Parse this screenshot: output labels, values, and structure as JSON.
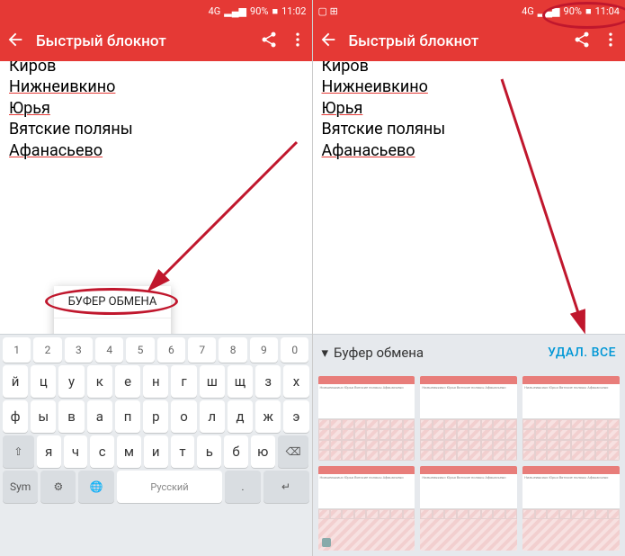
{
  "left": {
    "status": {
      "network": "4G",
      "signal": "▂▄▆",
      "battery_pct": "90%",
      "time": "11:02"
    },
    "appbar": {
      "title": "Быстрый блокнот"
    },
    "notes": [
      "Киров",
      "Нижнеивкино",
      "Юрья",
      "Вятские поляны",
      "Афанасьево"
    ],
    "underlined": [
      "Нижнеивкино",
      "Юрья",
      "Афанасьево"
    ],
    "popup": {
      "label": "БУФЕР ОБМЕНА",
      "back": "←"
    },
    "keyboard": {
      "nums": [
        "1",
        "2",
        "3",
        "4",
        "5",
        "6",
        "7",
        "8",
        "9",
        "0"
      ],
      "row1": [
        "й",
        "ц",
        "у",
        "к",
        "е",
        "н",
        "г",
        "ш",
        "щ",
        "з",
        "х"
      ],
      "row2": [
        "ф",
        "ы",
        "в",
        "а",
        "п",
        "р",
        "о",
        "л",
        "д",
        "ж",
        "э"
      ],
      "row3": [
        "я",
        "ч",
        "с",
        "м",
        "и",
        "т",
        "ь",
        "б",
        "ю"
      ],
      "shift": "⇧",
      "bksp": "⌫",
      "sym": "Sym",
      "gear": "⚙",
      "globe": "🌐",
      "lang": "Русский",
      "dot": ".",
      "enter": "↵"
    }
  },
  "right": {
    "status": {
      "network": "4G",
      "signal": "▂▄▆",
      "battery_pct": "90%",
      "time": "11:04",
      "icons": "▢ ⊞"
    },
    "appbar": {
      "title": "Быстрый блокнот"
    },
    "notes": [
      "Киров",
      "Нижнеивкино",
      "Юрья",
      "Вятские поляны",
      "Афанасьево"
    ],
    "underlined": [
      "Нижнеивкино",
      "Юрья",
      "Афанасьево"
    ],
    "clipboard": {
      "title": "Буфер обмена",
      "delete_all": "УДАЛ. ВСЕ",
      "thumb_text": "Нижнеивкино\nЮрья\nВятские поляны\nАфанасьево"
    }
  }
}
